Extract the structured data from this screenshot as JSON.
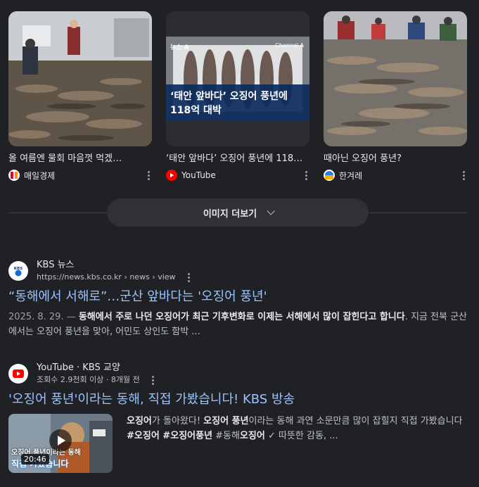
{
  "image_cards": [
    {
      "title": "올 여름엔 물회 마음껏 먹겠…",
      "source": "매일경제"
    },
    {
      "title": "‘태안 앞바다’ 오징어 풍년에 118…",
      "source": "YouTube",
      "overlay_line1": "‘태안 앞바다’ 오징어 풍년에",
      "overlay_line2": "118억 대박",
      "tag_left": "뉴스 A",
      "tag_right": "Channel A"
    },
    {
      "title": "때아닌 오징어 풍년?",
      "source": "한겨레"
    }
  ],
  "more_images": {
    "label": "이미지 더보기"
  },
  "result1": {
    "site_name": "KBS 뉴스",
    "favicon_text": "KBS",
    "url": "https://news.kbs.co.kr › news › view",
    "title": "“동해에서 서해로”…군산 앞바다는 '오징어 풍년'",
    "date": "2025. 8. 29. —",
    "snippet_bold": "동해에서 주로 나던 오징어가 최근 기후변화로 이제는 서해에서 많이 잡힌다고 합니다",
    "snippet_rest": ". 지금 전북 군산에서는 오징어 풍년을 맞아, 어민도 상인도 함박 ..."
  },
  "result2": {
    "site_name": "YouTube · KBS 교양",
    "meta": "조회수 2.9천회 이상 · 8개월 전",
    "title": "'오징어 풍년'이라는 동해, 직접 가봤습니다! KBS 방송",
    "duration": "20:46",
    "thumb_caption1": "오징어 풍년이라는 동해",
    "thumb_caption2": "직접 가봤습니다",
    "snippet": {
      "p1": "오징어",
      "p2": "가 돌아왔다! ",
      "p3": "오징어 풍년",
      "p4": "이라는 동해 과연 소문만큼 많이 잡힐지 직접 가봤습니다 ",
      "p5": "#오징어 #오징어풍년",
      "p6": " #동해",
      "p7": "오징어",
      "p8": " ✓ 따뜻한 감동, ..."
    }
  },
  "colors": {
    "background": "#202124",
    "link": "#99c3ff",
    "youtube": "#ff0000"
  }
}
